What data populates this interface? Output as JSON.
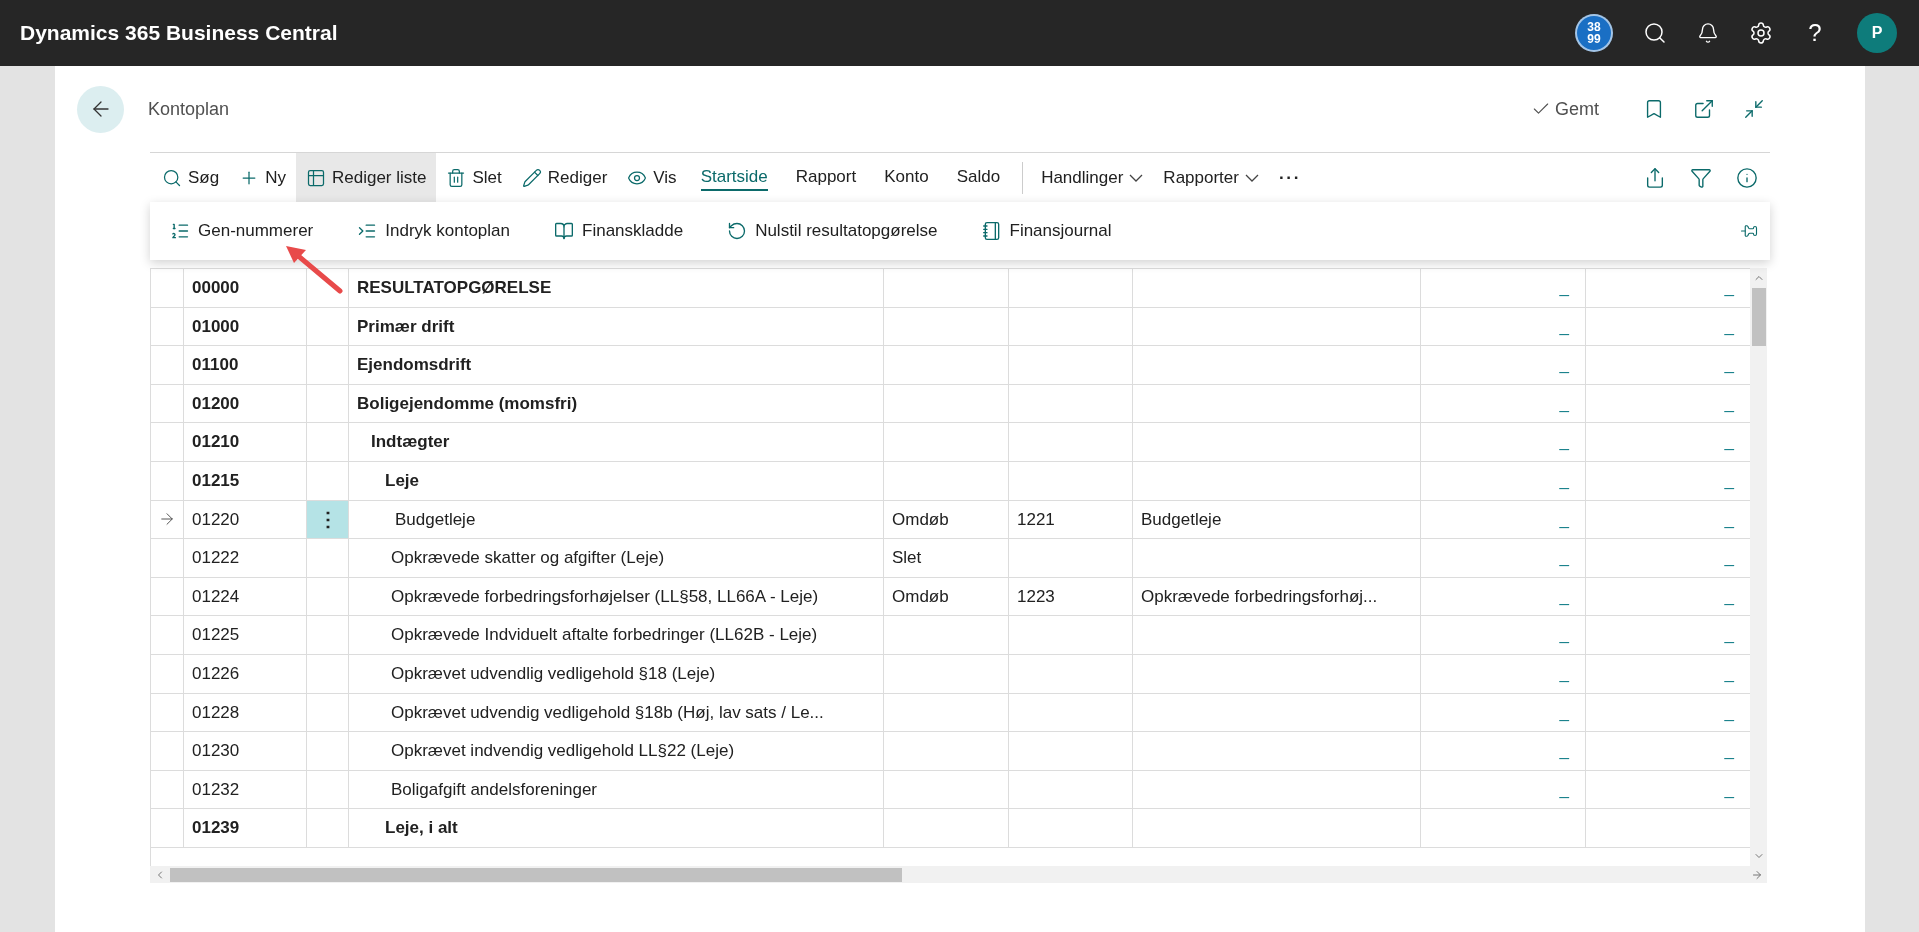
{
  "app_bar": {
    "title": "Dynamics 365 Business Central",
    "badge_lines": [
      "38",
      "99"
    ],
    "help": "?",
    "avatar": "P"
  },
  "page": {
    "title": "Kontoplan",
    "saved": "Gemt"
  },
  "toolbar": [
    {
      "kind": "button",
      "label": "Søg",
      "pressed": false
    },
    {
      "kind": "button",
      "label": "Ny",
      "pressed": false
    },
    {
      "kind": "button",
      "label": "Rediger liste",
      "pressed": true
    },
    {
      "kind": "button",
      "label": "Slet",
      "pressed": false
    },
    {
      "kind": "button",
      "label": "Rediger",
      "pressed": false
    },
    {
      "kind": "button",
      "label": "Vis",
      "pressed": false
    },
    {
      "kind": "tab",
      "label": "Startside",
      "selected": true
    },
    {
      "kind": "tab",
      "label": "Rapport",
      "selected": false
    },
    {
      "kind": "tab",
      "label": "Konto",
      "selected": false
    },
    {
      "kind": "tab",
      "label": "Saldo",
      "selected": false
    },
    {
      "kind": "menu",
      "label": "Handlinger"
    },
    {
      "kind": "menu",
      "label": "Rapporter"
    },
    {
      "kind": "more",
      "label": "···"
    }
  ],
  "actions": [
    {
      "label": "Gen-nummerer"
    },
    {
      "label": "Indryk kontoplan"
    },
    {
      "label": "Finanskladde"
    },
    {
      "label": "Nulstil resultatopgørelse"
    },
    {
      "label": "Finansjournal"
    }
  ],
  "rows": [
    {
      "number": "00000",
      "name": "RESULTATOPGØRELSE",
      "kind": "heading",
      "selected": false,
      "column_8": "_",
      "balance": "_"
    },
    {
      "number": "01000",
      "name": "Primær drift",
      "kind": "heading",
      "selected": false,
      "column_8": "_",
      "balance": "_"
    },
    {
      "number": "01100",
      "name": "Ejendomsdrift",
      "kind": "heading",
      "selected": false,
      "column_8": "_",
      "balance": "_"
    },
    {
      "number": "01200",
      "name": "Boligejendomme (momsfri)",
      "kind": "heading",
      "selected": false,
      "column_8": "_",
      "balance": "_",
      "children": [
        {
          "number": "01210",
          "name": "Indtægter",
          "kind": "heading",
          "selected": false,
          "column_8": "_",
          "balance": "_",
          "children": [
            {
              "number": "01215",
              "name": "Leje",
              "kind": "heading",
              "selected": false,
              "column_8": "_",
              "balance": "_",
              "children": [
                {
                  "number": "01220",
                  "name": "Budgetleje",
                  "kind": "posting",
                  "selected": true,
                  "row_menu": "⋮",
                  "action": "Omdøb",
                  "new_number": "1221",
                  "new_name": "Budgetleje",
                  "column_8": "_",
                  "balance": "_"
                },
                {
                  "number": "01222",
                  "name": "Opkrævede skatter og afgifter (Leje)",
                  "kind": "posting",
                  "selected": false,
                  "action": "Slet",
                  "column_8": "_",
                  "balance": "_"
                },
                {
                  "number": "01224",
                  "name": "Opkrævede forbedringsforhøjelser (LL§58, LL66A - Leje)",
                  "kind": "posting",
                  "selected": false,
                  "action": "Omdøb",
                  "new_number": "1223",
                  "new_name": "Opkrævede forbedringsforhøj...",
                  "column_8": "_",
                  "balance": "_"
                },
                {
                  "number": "01225",
                  "name": "Opkrævede Indviduelt aftalte forbedringer (LL62B - Leje)",
                  "kind": "posting",
                  "selected": false,
                  "column_8": "_",
                  "balance": "_"
                },
                {
                  "number": "01226",
                  "name": "Opkrævet udvendlig vedligehold §18 (Leje)",
                  "kind": "posting",
                  "selected": false,
                  "column_8": "_",
                  "balance": "_"
                },
                {
                  "number": "01228",
                  "name": "Opkrævet udvendig vedligehold §18b (Høj, lav sats / Le...",
                  "kind": "posting",
                  "selected": false,
                  "column_8": "_",
                  "balance": "_"
                },
                {
                  "number": "01230",
                  "name": "Opkrævet indvendig vedligehold LL§22 (Leje)",
                  "kind": "posting",
                  "selected": false,
                  "column_8": "_",
                  "balance": "_"
                },
                {
                  "number": "01232",
                  "name": "Boligafgift andelsforeninger",
                  "kind": "posting",
                  "selected": false,
                  "column_8": "_",
                  "balance": "_"
                }
              ]
            },
            {
              "number": "01239",
              "name": "Leje, i alt",
              "kind": "heading",
              "selected": false
            }
          ]
        }
      ]
    }
  ]
}
